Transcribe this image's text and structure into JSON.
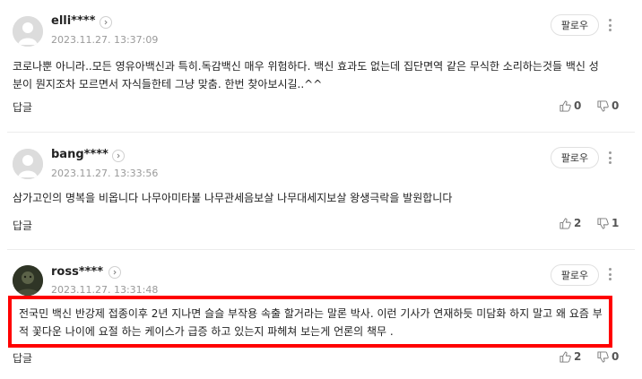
{
  "comments": [
    {
      "nickname": "elli****",
      "date": "2023.11.27. 13:37:09",
      "follow_label": "팔로우",
      "text": "코로나뿐 아니라..모든 영유아백신과 특히.독감백신 매우 위험하다. 백신 효과도 없는데 집단면역 같은 무식한 소리하는것들 백신 성분이 뭔지조차 모르면서 자식들한테 그냥 맞춤. 한번 찾아보시길..^^",
      "reply_label": "답글",
      "likes": "0",
      "dislikes": "0"
    },
    {
      "nickname": "bang****",
      "date": "2023.11.27. 13:33:56",
      "follow_label": "팔로우",
      "text": "삼가고인의 명복을 비옵니다 나무아미타불 나무관세음보살 나무대세지보살 왕생극락을 발원합니다",
      "reply_label": "답글",
      "likes": "2",
      "dislikes": "1"
    },
    {
      "nickname": "ross****",
      "date": "2023.11.27. 13:31:48",
      "follow_label": "팔로우",
      "text": "전국민 백신 반강제 접종이후 2년 지나면 슬슬 부작용 속출 할거라는 말론 박사. 이런 기사가 연재하듯 미담화 하지 말고 왜 요즘 부적 꽃다운 나이에 요절 하는 케이스가 급증 하고 있는지 파헤쳐 보는게 언론의 책무 .",
      "reply_label": "답글",
      "likes": "2",
      "dislikes": "0"
    }
  ],
  "colors": {
    "highlight": "#ff0000",
    "muted": "#9a9a9a"
  },
  "icons": [
    "chevron-right-icon",
    "more-icon",
    "thumbs-up-icon",
    "thumbs-down-icon",
    "avatar-icon"
  ]
}
